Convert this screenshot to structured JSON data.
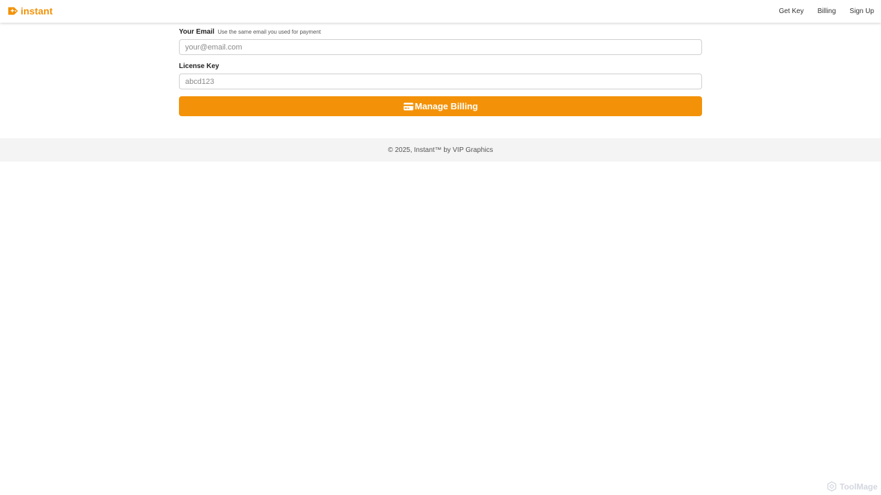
{
  "header": {
    "brand": "instant",
    "logo_icon": "sparkle-tag-icon",
    "nav": [
      {
        "label": "Get Key"
      },
      {
        "label": "Billing"
      },
      {
        "label": "Sign Up"
      }
    ]
  },
  "form": {
    "email": {
      "label": "Your Email",
      "hint": "Use the same email you used for payment",
      "value": "",
      "placeholder": "your@email.com"
    },
    "license": {
      "label": "License Key",
      "value": "",
      "placeholder": "abcd123"
    },
    "submit": {
      "icon": "credit-card-icon",
      "label": "Manage Billing"
    }
  },
  "footer": {
    "text": "© 2025, Instant™ by VIP Graphics"
  },
  "watermark": {
    "text": "ToolMage",
    "icon": "hexagon-logo-icon"
  },
  "colors": {
    "accent": "#f39208",
    "footer_bg": "#f4f4f4",
    "input_border": "#cfcfcf"
  }
}
